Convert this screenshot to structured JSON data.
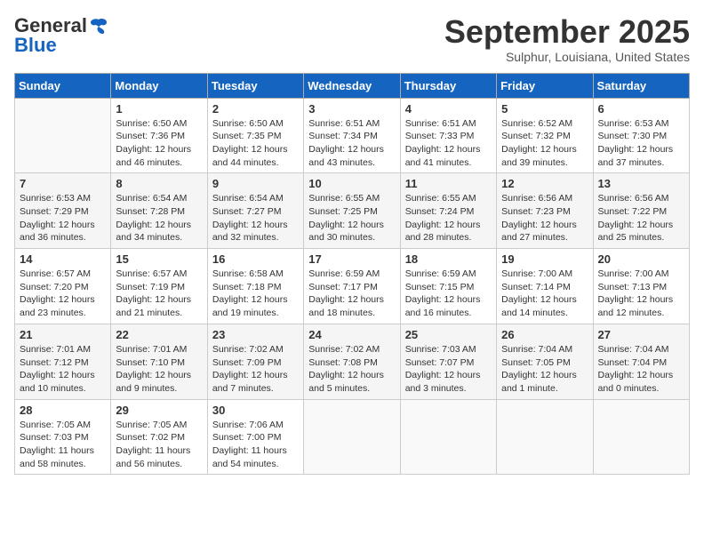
{
  "header": {
    "logo_general": "General",
    "logo_blue": "Blue",
    "month": "September 2025",
    "location": "Sulphur, Louisiana, United States"
  },
  "weekdays": [
    "Sunday",
    "Monday",
    "Tuesday",
    "Wednesday",
    "Thursday",
    "Friday",
    "Saturday"
  ],
  "weeks": [
    [
      {
        "day": "",
        "info": ""
      },
      {
        "day": "1",
        "info": "Sunrise: 6:50 AM\nSunset: 7:36 PM\nDaylight: 12 hours\nand 46 minutes."
      },
      {
        "day": "2",
        "info": "Sunrise: 6:50 AM\nSunset: 7:35 PM\nDaylight: 12 hours\nand 44 minutes."
      },
      {
        "day": "3",
        "info": "Sunrise: 6:51 AM\nSunset: 7:34 PM\nDaylight: 12 hours\nand 43 minutes."
      },
      {
        "day": "4",
        "info": "Sunrise: 6:51 AM\nSunset: 7:33 PM\nDaylight: 12 hours\nand 41 minutes."
      },
      {
        "day": "5",
        "info": "Sunrise: 6:52 AM\nSunset: 7:32 PM\nDaylight: 12 hours\nand 39 minutes."
      },
      {
        "day": "6",
        "info": "Sunrise: 6:53 AM\nSunset: 7:30 PM\nDaylight: 12 hours\nand 37 minutes."
      }
    ],
    [
      {
        "day": "7",
        "info": "Sunrise: 6:53 AM\nSunset: 7:29 PM\nDaylight: 12 hours\nand 36 minutes."
      },
      {
        "day": "8",
        "info": "Sunrise: 6:54 AM\nSunset: 7:28 PM\nDaylight: 12 hours\nand 34 minutes."
      },
      {
        "day": "9",
        "info": "Sunrise: 6:54 AM\nSunset: 7:27 PM\nDaylight: 12 hours\nand 32 minutes."
      },
      {
        "day": "10",
        "info": "Sunrise: 6:55 AM\nSunset: 7:25 PM\nDaylight: 12 hours\nand 30 minutes."
      },
      {
        "day": "11",
        "info": "Sunrise: 6:55 AM\nSunset: 7:24 PM\nDaylight: 12 hours\nand 28 minutes."
      },
      {
        "day": "12",
        "info": "Sunrise: 6:56 AM\nSunset: 7:23 PM\nDaylight: 12 hours\nand 27 minutes."
      },
      {
        "day": "13",
        "info": "Sunrise: 6:56 AM\nSunset: 7:22 PM\nDaylight: 12 hours\nand 25 minutes."
      }
    ],
    [
      {
        "day": "14",
        "info": "Sunrise: 6:57 AM\nSunset: 7:20 PM\nDaylight: 12 hours\nand 23 minutes."
      },
      {
        "day": "15",
        "info": "Sunrise: 6:57 AM\nSunset: 7:19 PM\nDaylight: 12 hours\nand 21 minutes."
      },
      {
        "day": "16",
        "info": "Sunrise: 6:58 AM\nSunset: 7:18 PM\nDaylight: 12 hours\nand 19 minutes."
      },
      {
        "day": "17",
        "info": "Sunrise: 6:59 AM\nSunset: 7:17 PM\nDaylight: 12 hours\nand 18 minutes."
      },
      {
        "day": "18",
        "info": "Sunrise: 6:59 AM\nSunset: 7:15 PM\nDaylight: 12 hours\nand 16 minutes."
      },
      {
        "day": "19",
        "info": "Sunrise: 7:00 AM\nSunset: 7:14 PM\nDaylight: 12 hours\nand 14 minutes."
      },
      {
        "day": "20",
        "info": "Sunrise: 7:00 AM\nSunset: 7:13 PM\nDaylight: 12 hours\nand 12 minutes."
      }
    ],
    [
      {
        "day": "21",
        "info": "Sunrise: 7:01 AM\nSunset: 7:12 PM\nDaylight: 12 hours\nand 10 minutes."
      },
      {
        "day": "22",
        "info": "Sunrise: 7:01 AM\nSunset: 7:10 PM\nDaylight: 12 hours\nand 9 minutes."
      },
      {
        "day": "23",
        "info": "Sunrise: 7:02 AM\nSunset: 7:09 PM\nDaylight: 12 hours\nand 7 minutes."
      },
      {
        "day": "24",
        "info": "Sunrise: 7:02 AM\nSunset: 7:08 PM\nDaylight: 12 hours\nand 5 minutes."
      },
      {
        "day": "25",
        "info": "Sunrise: 7:03 AM\nSunset: 7:07 PM\nDaylight: 12 hours\nand 3 minutes."
      },
      {
        "day": "26",
        "info": "Sunrise: 7:04 AM\nSunset: 7:05 PM\nDaylight: 12 hours\nand 1 minute."
      },
      {
        "day": "27",
        "info": "Sunrise: 7:04 AM\nSunset: 7:04 PM\nDaylight: 12 hours\nand 0 minutes."
      }
    ],
    [
      {
        "day": "28",
        "info": "Sunrise: 7:05 AM\nSunset: 7:03 PM\nDaylight: 11 hours\nand 58 minutes."
      },
      {
        "day": "29",
        "info": "Sunrise: 7:05 AM\nSunset: 7:02 PM\nDaylight: 11 hours\nand 56 minutes."
      },
      {
        "day": "30",
        "info": "Sunrise: 7:06 AM\nSunset: 7:00 PM\nDaylight: 11 hours\nand 54 minutes."
      },
      {
        "day": "",
        "info": ""
      },
      {
        "day": "",
        "info": ""
      },
      {
        "day": "",
        "info": ""
      },
      {
        "day": "",
        "info": ""
      }
    ]
  ]
}
